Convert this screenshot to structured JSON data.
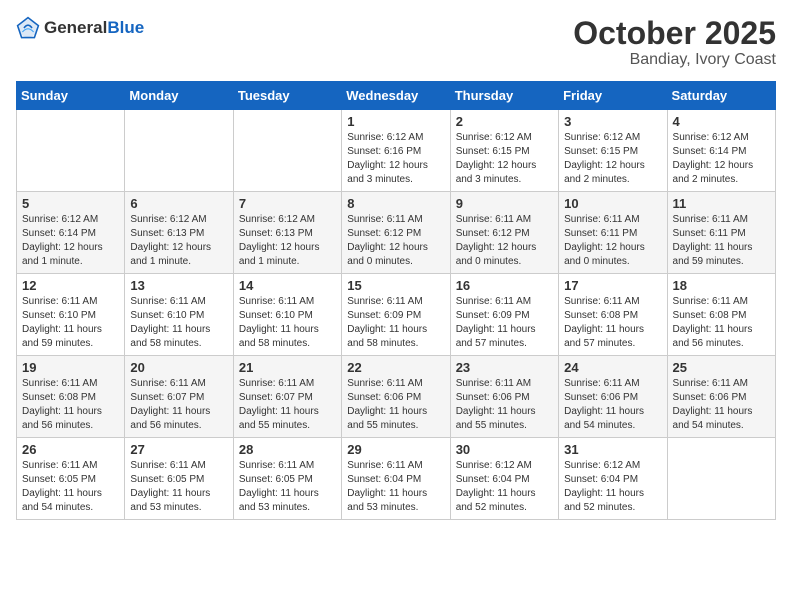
{
  "header": {
    "logo_general": "General",
    "logo_blue": "Blue",
    "title": "October 2025",
    "subtitle": "Bandiay, Ivory Coast"
  },
  "weekdays": [
    "Sunday",
    "Monday",
    "Tuesday",
    "Wednesday",
    "Thursday",
    "Friday",
    "Saturday"
  ],
  "weeks": [
    [
      {
        "day": "",
        "info": ""
      },
      {
        "day": "",
        "info": ""
      },
      {
        "day": "",
        "info": ""
      },
      {
        "day": "1",
        "info": "Sunrise: 6:12 AM\nSunset: 6:16 PM\nDaylight: 12 hours\nand 3 minutes."
      },
      {
        "day": "2",
        "info": "Sunrise: 6:12 AM\nSunset: 6:15 PM\nDaylight: 12 hours\nand 3 minutes."
      },
      {
        "day": "3",
        "info": "Sunrise: 6:12 AM\nSunset: 6:15 PM\nDaylight: 12 hours\nand 2 minutes."
      },
      {
        "day": "4",
        "info": "Sunrise: 6:12 AM\nSunset: 6:14 PM\nDaylight: 12 hours\nand 2 minutes."
      }
    ],
    [
      {
        "day": "5",
        "info": "Sunrise: 6:12 AM\nSunset: 6:14 PM\nDaylight: 12 hours\nand 1 minute."
      },
      {
        "day": "6",
        "info": "Sunrise: 6:12 AM\nSunset: 6:13 PM\nDaylight: 12 hours\nand 1 minute."
      },
      {
        "day": "7",
        "info": "Sunrise: 6:12 AM\nSunset: 6:13 PM\nDaylight: 12 hours\nand 1 minute."
      },
      {
        "day": "8",
        "info": "Sunrise: 6:11 AM\nSunset: 6:12 PM\nDaylight: 12 hours\nand 0 minutes."
      },
      {
        "day": "9",
        "info": "Sunrise: 6:11 AM\nSunset: 6:12 PM\nDaylight: 12 hours\nand 0 minutes."
      },
      {
        "day": "10",
        "info": "Sunrise: 6:11 AM\nSunset: 6:11 PM\nDaylight: 12 hours\nand 0 minutes."
      },
      {
        "day": "11",
        "info": "Sunrise: 6:11 AM\nSunset: 6:11 PM\nDaylight: 11 hours\nand 59 minutes."
      }
    ],
    [
      {
        "day": "12",
        "info": "Sunrise: 6:11 AM\nSunset: 6:10 PM\nDaylight: 11 hours\nand 59 minutes."
      },
      {
        "day": "13",
        "info": "Sunrise: 6:11 AM\nSunset: 6:10 PM\nDaylight: 11 hours\nand 58 minutes."
      },
      {
        "day": "14",
        "info": "Sunrise: 6:11 AM\nSunset: 6:10 PM\nDaylight: 11 hours\nand 58 minutes."
      },
      {
        "day": "15",
        "info": "Sunrise: 6:11 AM\nSunset: 6:09 PM\nDaylight: 11 hours\nand 58 minutes."
      },
      {
        "day": "16",
        "info": "Sunrise: 6:11 AM\nSunset: 6:09 PM\nDaylight: 11 hours\nand 57 minutes."
      },
      {
        "day": "17",
        "info": "Sunrise: 6:11 AM\nSunset: 6:08 PM\nDaylight: 11 hours\nand 57 minutes."
      },
      {
        "day": "18",
        "info": "Sunrise: 6:11 AM\nSunset: 6:08 PM\nDaylight: 11 hours\nand 56 minutes."
      }
    ],
    [
      {
        "day": "19",
        "info": "Sunrise: 6:11 AM\nSunset: 6:08 PM\nDaylight: 11 hours\nand 56 minutes."
      },
      {
        "day": "20",
        "info": "Sunrise: 6:11 AM\nSunset: 6:07 PM\nDaylight: 11 hours\nand 56 minutes."
      },
      {
        "day": "21",
        "info": "Sunrise: 6:11 AM\nSunset: 6:07 PM\nDaylight: 11 hours\nand 55 minutes."
      },
      {
        "day": "22",
        "info": "Sunrise: 6:11 AM\nSunset: 6:06 PM\nDaylight: 11 hours\nand 55 minutes."
      },
      {
        "day": "23",
        "info": "Sunrise: 6:11 AM\nSunset: 6:06 PM\nDaylight: 11 hours\nand 55 minutes."
      },
      {
        "day": "24",
        "info": "Sunrise: 6:11 AM\nSunset: 6:06 PM\nDaylight: 11 hours\nand 54 minutes."
      },
      {
        "day": "25",
        "info": "Sunrise: 6:11 AM\nSunset: 6:06 PM\nDaylight: 11 hours\nand 54 minutes."
      }
    ],
    [
      {
        "day": "26",
        "info": "Sunrise: 6:11 AM\nSunset: 6:05 PM\nDaylight: 11 hours\nand 54 minutes."
      },
      {
        "day": "27",
        "info": "Sunrise: 6:11 AM\nSunset: 6:05 PM\nDaylight: 11 hours\nand 53 minutes."
      },
      {
        "day": "28",
        "info": "Sunrise: 6:11 AM\nSunset: 6:05 PM\nDaylight: 11 hours\nand 53 minutes."
      },
      {
        "day": "29",
        "info": "Sunrise: 6:11 AM\nSunset: 6:04 PM\nDaylight: 11 hours\nand 53 minutes."
      },
      {
        "day": "30",
        "info": "Sunrise: 6:12 AM\nSunset: 6:04 PM\nDaylight: 11 hours\nand 52 minutes."
      },
      {
        "day": "31",
        "info": "Sunrise: 6:12 AM\nSunset: 6:04 PM\nDaylight: 11 hours\nand 52 minutes."
      },
      {
        "day": "",
        "info": ""
      }
    ]
  ]
}
